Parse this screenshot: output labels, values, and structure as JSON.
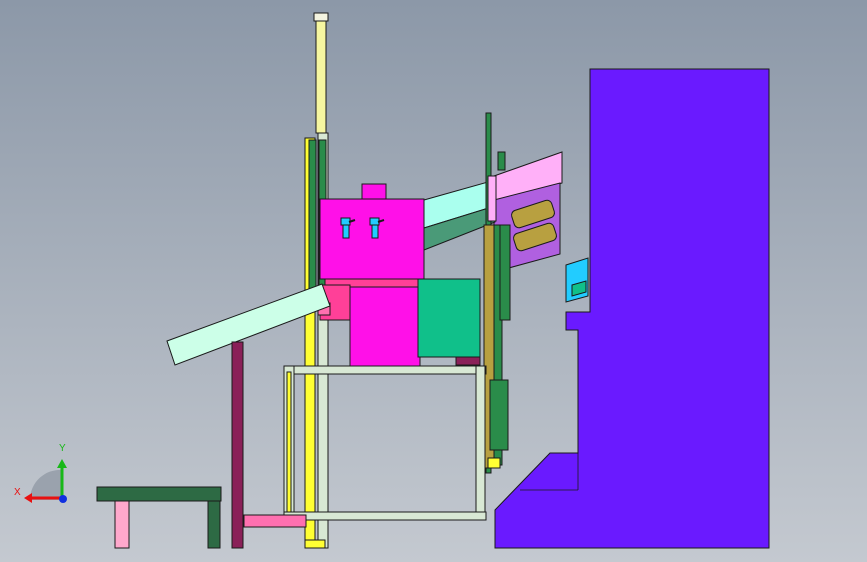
{
  "viewport": {
    "background_top": "#8c98a8",
    "background_bottom": "#c4c9d0"
  },
  "colors": {
    "housing": "#6a1aff",
    "body": "#ff10e8",
    "teal_box": "#10c08a",
    "light_cyan": "#aaffee",
    "pale_green": "#ccffe8",
    "lavender": "#ffb0f8",
    "violet": "#b060e0",
    "yellow": "#ffff33",
    "frame": "#d8e8d4",
    "bench": "#2d6a44",
    "pink": "#ff70b0",
    "maroon": "#8a2058",
    "olive": "#b8a040",
    "green_rail": "#2a8c4a",
    "cyan": "#22ccff",
    "triad_x": "#e81010",
    "triad_y": "#18b818",
    "triad_z": "#1030e0"
  },
  "triad": {
    "x_label": "X",
    "y_label": "Y",
    "x_icon": "x-axis-arrow-icon",
    "y_icon": "y-axis-arrow-icon",
    "z_icon": "z-axis-dot-icon"
  }
}
